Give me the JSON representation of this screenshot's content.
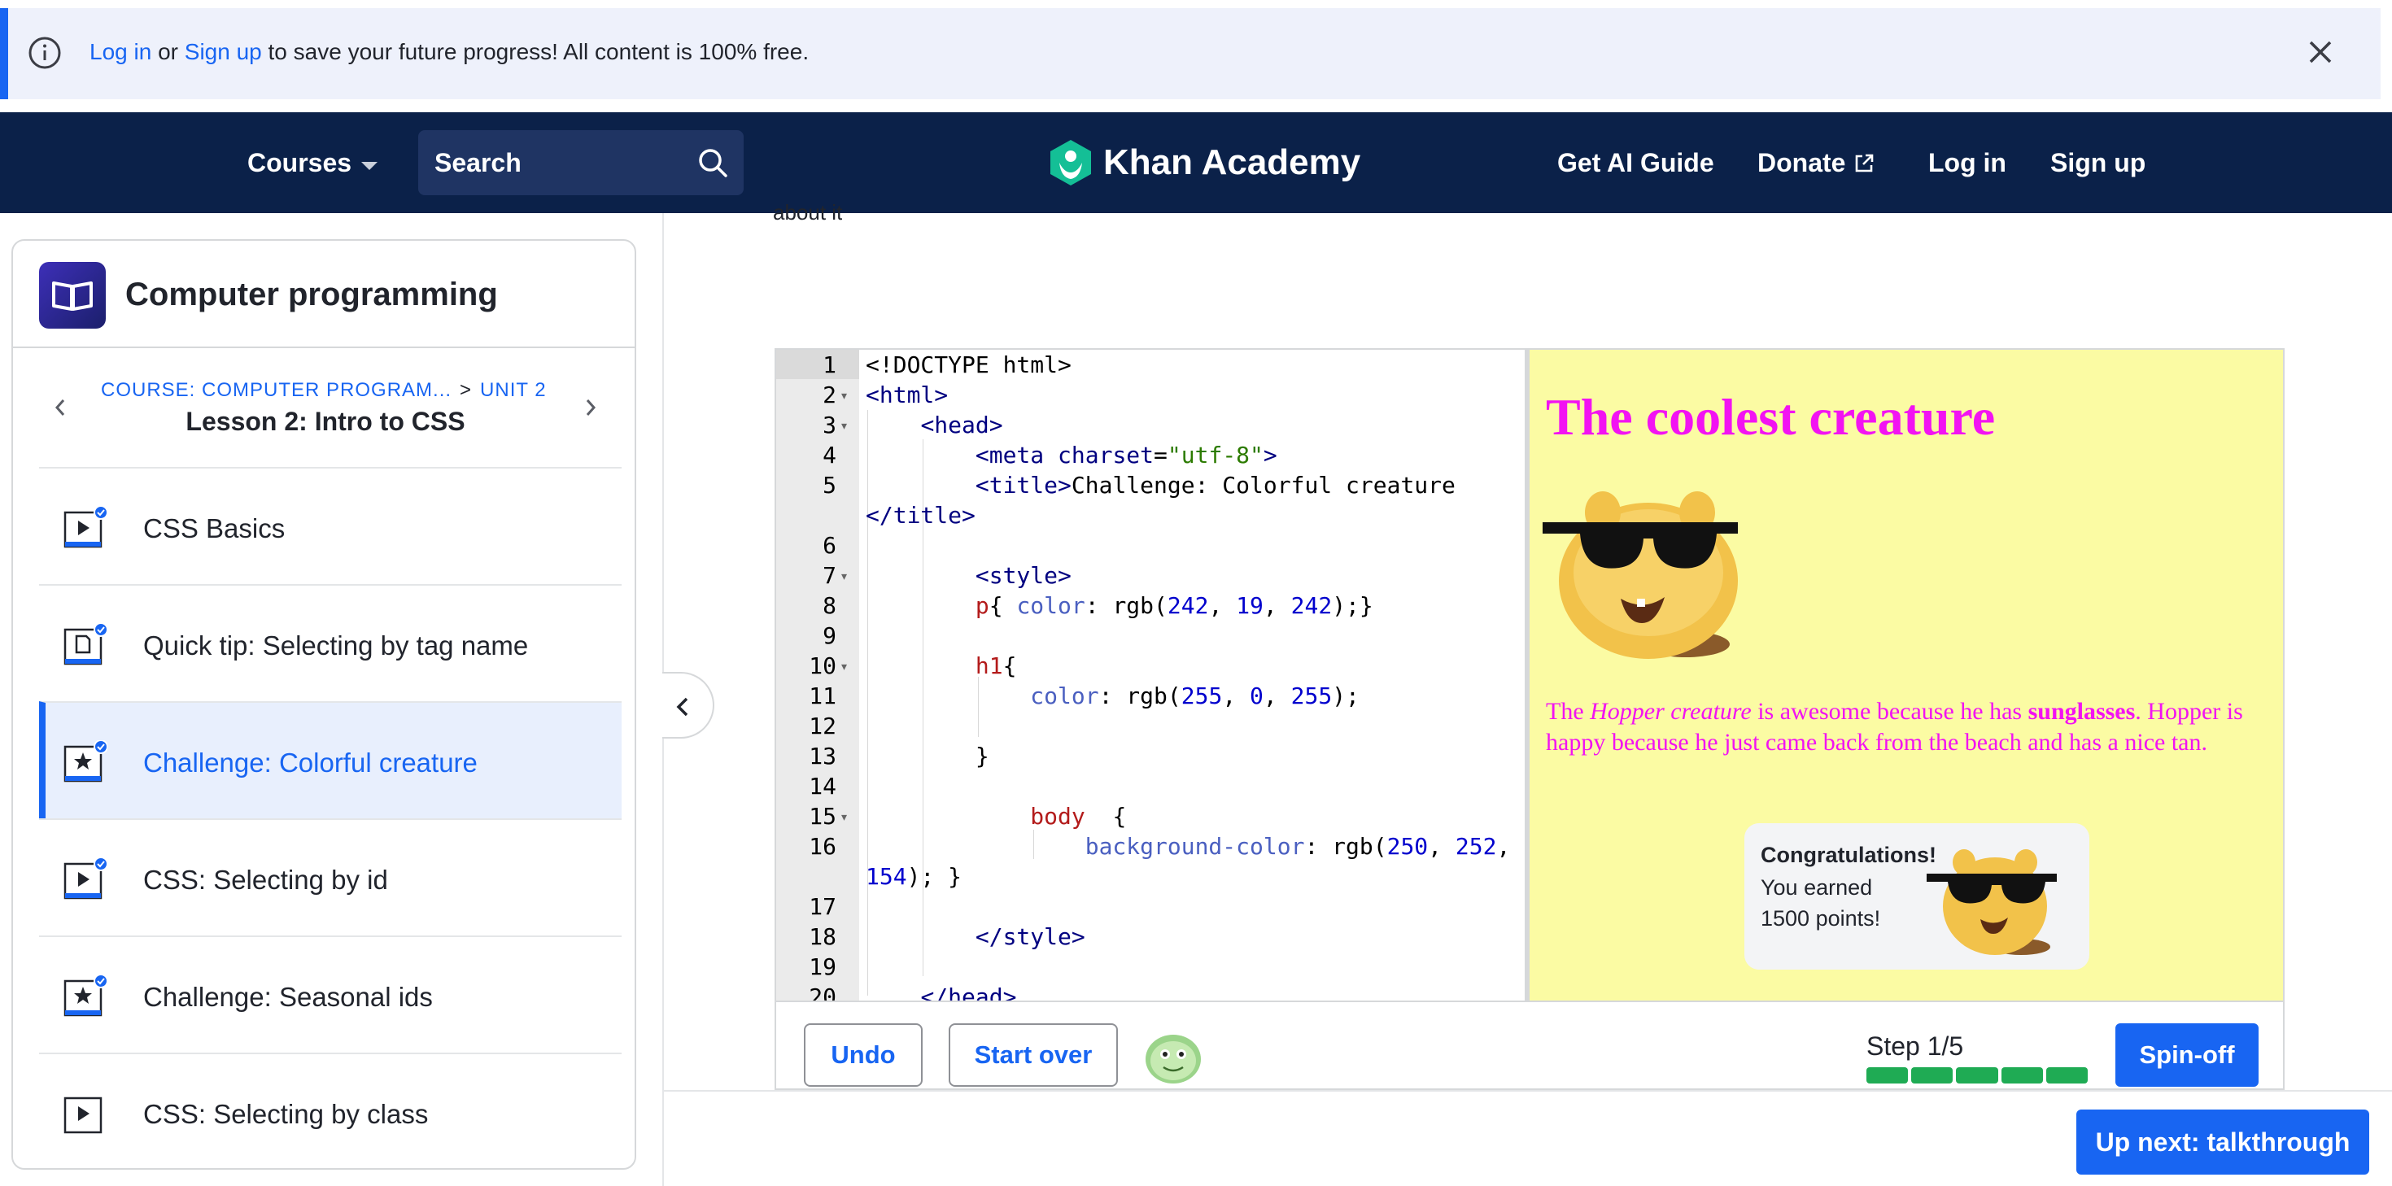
{
  "banner": {
    "login_link": "Log in",
    "or_text": "or",
    "signup_link": "Sign up",
    "message": "to save your future progress! All content is 100% free."
  },
  "nav": {
    "courses": "Courses",
    "search_placeholder": "Search",
    "brand": "Khan Academy",
    "ai_guide": "Get AI Guide",
    "donate": "Donate",
    "login": "Log in",
    "signup": "Sign up"
  },
  "sidebar": {
    "title": "Computer programming",
    "course_crumb": "COURSE: COMPUTER PROGRAM...",
    "unit_crumb": "UNIT 2",
    "crumb_sep": ">",
    "lesson": "Lesson 2: Intro to CSS",
    "items": [
      {
        "label": "CSS Basics",
        "icon": "video-icon",
        "done": true
      },
      {
        "label": "Quick tip: Selecting by tag name",
        "icon": "article-icon",
        "done": true
      },
      {
        "label": "Challenge: Colorful creature",
        "icon": "star-icon",
        "done": true,
        "active": true
      },
      {
        "label": "CSS: Selecting by id",
        "icon": "video-icon",
        "done": true
      },
      {
        "label": "Challenge: Seasonal ids",
        "icon": "star-icon",
        "done": true
      },
      {
        "label": "CSS: Selecting by class",
        "icon": "video-icon",
        "done": false
      }
    ]
  },
  "main": {
    "about_text": "about it"
  },
  "editor": {
    "line_numbers": [
      "1",
      "2",
      "3",
      "4",
      "5",
      "",
      "6",
      "7",
      "8",
      "9",
      "10",
      "11",
      "12",
      "13",
      "14",
      "15",
      "16",
      "",
      "17",
      "18",
      "19",
      "20"
    ]
  },
  "preview": {
    "heading": "The coolest creature",
    "para_1": "The ",
    "para_em": "Hopper creature",
    "para_2": " is awesome because he has ",
    "para_strong": "sunglasses",
    "para_3": ". Hopper is happy because he just came back from the beach and has a nice tan."
  },
  "congrats": {
    "title": "Congratulations!",
    "line1": "You earned",
    "line2": "1500 points!"
  },
  "toolbar": {
    "undo": "Undo",
    "start_over": "Start over",
    "step": "Step 1/5",
    "spin_off": "Spin-off",
    "up_next": "Up next: talkthrough"
  },
  "colors": {
    "accent": "#1865f2",
    "nav_bg": "#0b2149",
    "preview_bg": "#fbfba3",
    "preview_text": "#f213f2",
    "progress": "#1fab54"
  }
}
